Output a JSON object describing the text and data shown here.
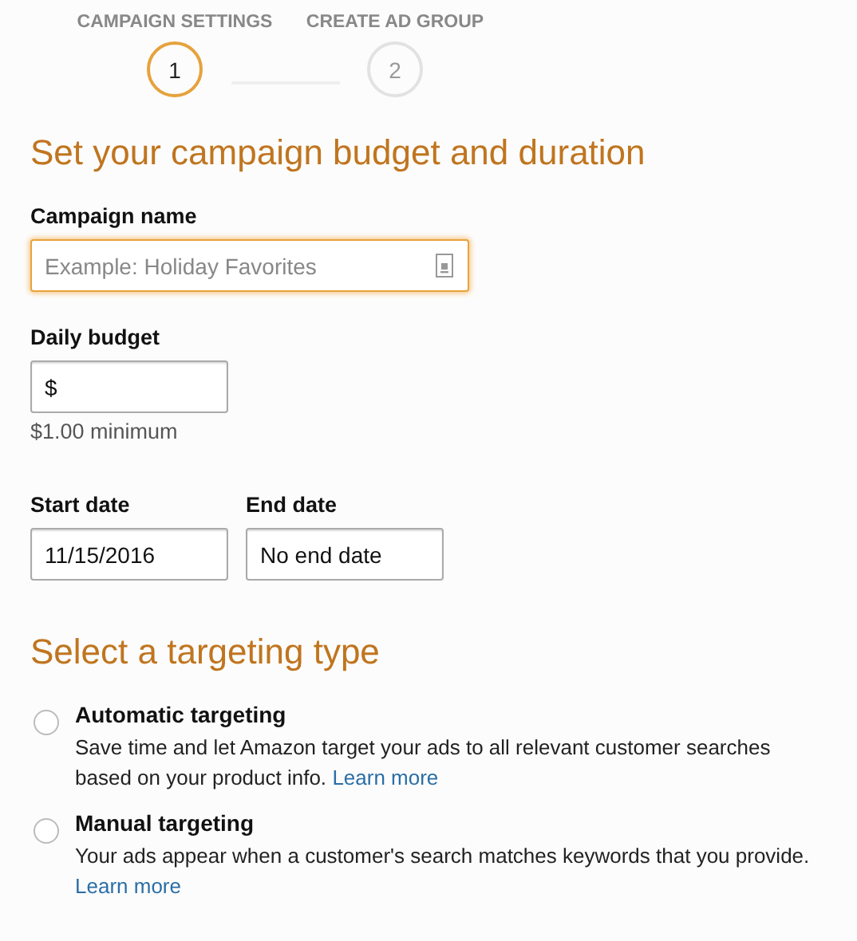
{
  "steps": [
    {
      "label": "CAMPAIGN SETTINGS",
      "number": "1",
      "selected": true
    },
    {
      "label": "CREATE AD GROUP",
      "number": "2",
      "selected": false
    }
  ],
  "budget_section": {
    "heading": "Set your campaign budget and duration",
    "campaign_name": {
      "label": "Campaign name",
      "placeholder": "Example: Holiday Favorites",
      "focused": true
    },
    "daily_budget": {
      "label": "Daily budget",
      "value": "$",
      "hint": "$1.00 minimum"
    },
    "start_date": {
      "label": "Start date",
      "value": "11/15/2016"
    },
    "end_date": {
      "label": "End date",
      "value": "No end date"
    }
  },
  "targeting_section": {
    "heading": "Select a targeting type",
    "options": [
      {
        "title": "Automatic targeting",
        "description": "Save time and let Amazon target your ads to all relevant customer searches based on your product info.",
        "link": "Learn more",
        "selected": false
      },
      {
        "title": "Manual targeting",
        "description": "Your ads appear when a customer's search matches keywords that you provide.",
        "link": "Learn more",
        "selected": false
      }
    ]
  }
}
